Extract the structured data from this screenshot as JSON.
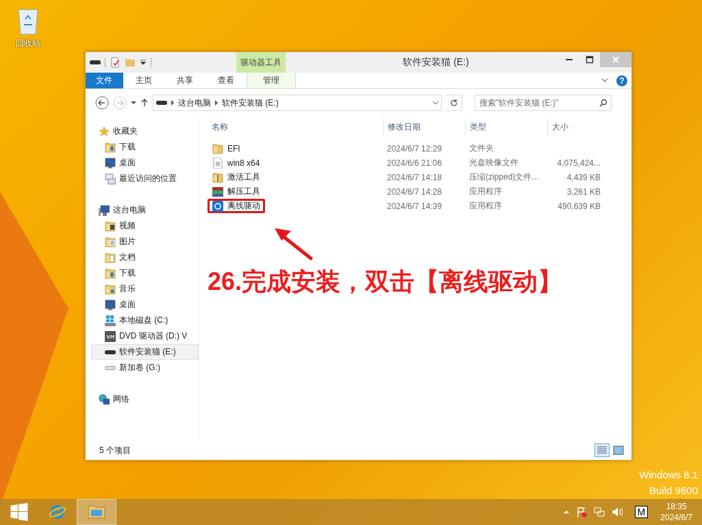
{
  "desktop": {
    "icons": [
      {
        "label": "回收站"
      }
    ],
    "os_label": "Windows 8.1",
    "build_label": "Build 9600"
  },
  "window": {
    "title": "软件安装猫 (E:)",
    "context_group": "驱动器工具",
    "ribbon_tabs": [
      {
        "label": "文件",
        "kind": "file"
      },
      {
        "label": "主页",
        "kind": "tab"
      },
      {
        "label": "共享",
        "kind": "tab"
      },
      {
        "label": "查看",
        "kind": "tab"
      },
      {
        "label": "管理",
        "kind": "context"
      }
    ],
    "help_glyph": "?",
    "address": {
      "crumbs": [
        "这台电脑",
        "软件安装猫 (E:)"
      ]
    },
    "search": {
      "placeholder": "搜索\"软件安装猫 (E:)\""
    },
    "sidebar": [
      {
        "label": "收藏夹",
        "kind": "star",
        "selected": false,
        "children": [
          {
            "label": "下载",
            "kind": "folder-download",
            "selected": false
          },
          {
            "label": "桌面",
            "kind": "desktop",
            "selected": false
          },
          {
            "label": "最近访问的位置",
            "kind": "recent",
            "selected": false
          }
        ]
      },
      {
        "label": "这台电脑",
        "kind": "computer",
        "selected": false,
        "children": [
          {
            "label": "视频",
            "kind": "folder-video",
            "selected": false
          },
          {
            "label": "图片",
            "kind": "folder-picture",
            "selected": false
          },
          {
            "label": "文档",
            "kind": "folder-doc",
            "selected": false
          },
          {
            "label": "下载",
            "kind": "folder-download",
            "selected": false
          },
          {
            "label": "音乐",
            "kind": "folder-music",
            "selected": false
          },
          {
            "label": "桌面",
            "kind": "desktop",
            "selected": false
          },
          {
            "label": "本地磁盘 (C:)",
            "kind": "drive-windows",
            "selected": false
          },
          {
            "label": "DVD 驱动器 (D:) V",
            "kind": "dvd",
            "selected": false
          },
          {
            "label": "软件安装猫 (E:)",
            "kind": "drive",
            "selected": true
          },
          {
            "label": "新加卷 (G:)",
            "kind": "drive-light",
            "selected": false
          }
        ]
      },
      {
        "label": "网络",
        "kind": "network",
        "selected": false
      }
    ],
    "columns": [
      "名称",
      "修改日期",
      "类型",
      "大小"
    ],
    "files": [
      {
        "name": "EFI",
        "kind": "folder",
        "date": "2024/6/7 12:29",
        "type": "文件夹",
        "highlighted": false
      },
      {
        "name": "win8 x64",
        "kind": "disc-image",
        "date": "2024/6/6 21:06",
        "type": "光盘映像文件",
        "size": "4,075,424...",
        "highlighted": false
      },
      {
        "name": "激活工具",
        "kind": "zip",
        "date": "2024/6/7 14:18",
        "type": "压缩(zipped)文件...",
        "size": "4,439 KB",
        "highlighted": false
      },
      {
        "name": "解压工具",
        "kind": "archiver",
        "date": "2024/6/7 14:28",
        "type": "应用程序",
        "size": "3,261 KB",
        "highlighted": false
      },
      {
        "name": "离线驱动",
        "kind": "app",
        "date": "2024/6/7 14:39",
        "type": "应用程序",
        "size": "490,639 KB",
        "highlighted": true
      }
    ],
    "status_bar": "5 个项目"
  },
  "annotation": {
    "text": "26.完成安装，双击【离线驱动】"
  },
  "taskbar": {
    "tray": {
      "key": "M",
      "time": "18:35",
      "date": "2024/6/7"
    }
  }
}
